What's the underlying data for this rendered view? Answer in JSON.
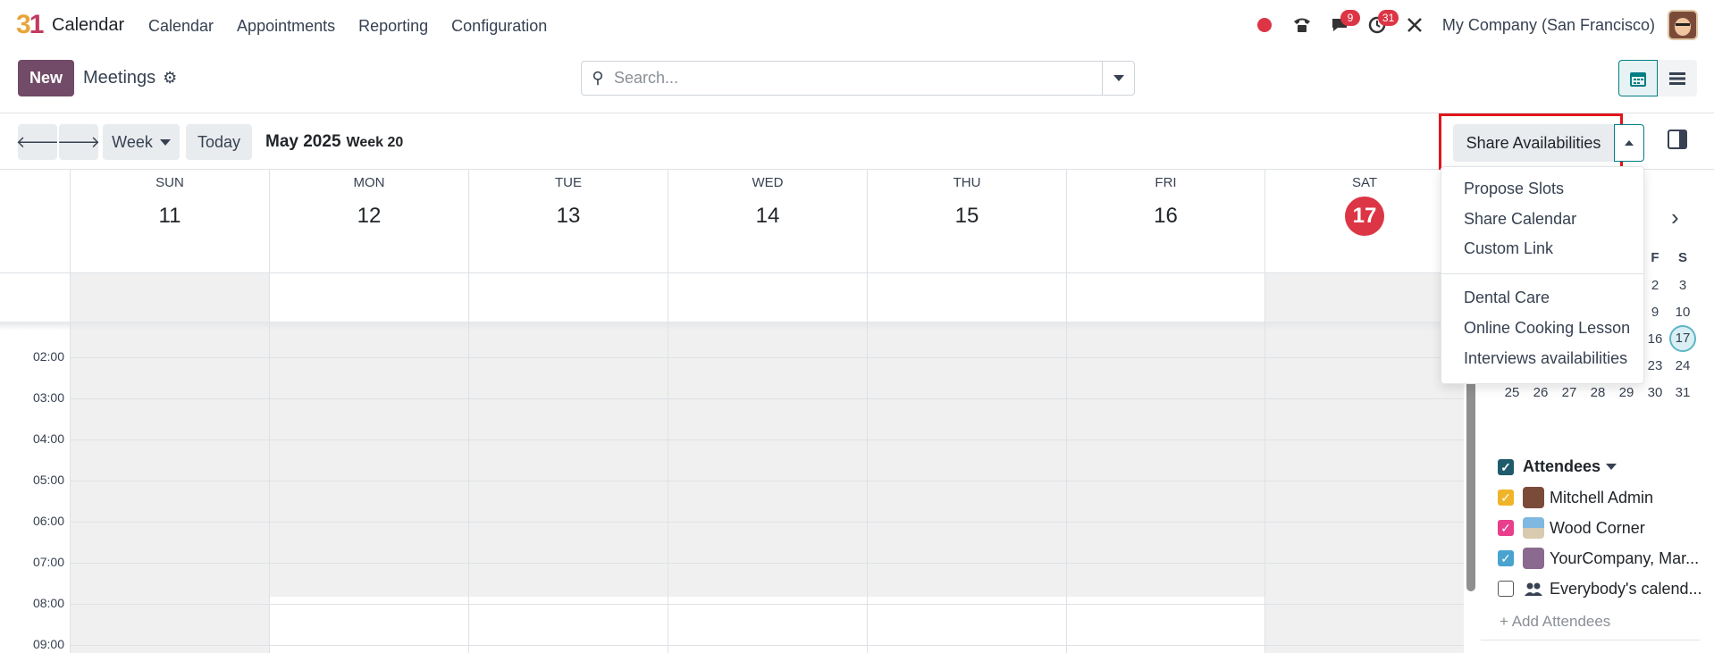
{
  "navbar": {
    "logo_digit_3": "3",
    "logo_digit_1": "1",
    "app_name": "Calendar",
    "menu": [
      "Calendar",
      "Appointments",
      "Reporting",
      "Configuration"
    ],
    "messages_count": "9",
    "activities_count": "31",
    "company": "My Company (San Francisco)"
  },
  "control_panel": {
    "new_label": "New",
    "title": "Meetings",
    "search_placeholder": "Search..."
  },
  "toolbar": {
    "scale_label": "Week",
    "today_label": "Today",
    "period": "May 2025",
    "week": "Week 20",
    "share_label": "Share Availabilities"
  },
  "calendar": {
    "days": [
      {
        "name": "SUN",
        "date": "11"
      },
      {
        "name": "MON",
        "date": "12"
      },
      {
        "name": "TUE",
        "date": "13"
      },
      {
        "name": "WED",
        "date": "14"
      },
      {
        "name": "THU",
        "date": "15"
      },
      {
        "name": "FRI",
        "date": "16"
      },
      {
        "name": "SAT",
        "date": "17"
      }
    ],
    "today_index": 6,
    "hours": [
      "02:00",
      "03:00",
      "04:00",
      "05:00",
      "06:00",
      "07:00",
      "08:00",
      "09:00"
    ]
  },
  "share_menu": {
    "items": [
      "Propose Slots",
      "Share Calendar",
      "Custom Link"
    ],
    "appointments": [
      "Dental Care",
      "Online Cooking Lesson",
      "Interviews availabilities"
    ]
  },
  "mini_calendar": {
    "headers": [
      "F",
      "S"
    ],
    "rows": [
      [
        "2",
        "3"
      ],
      [
        "9",
        "10"
      ],
      [
        "16",
        "17"
      ],
      [
        "23",
        "24"
      ],
      [
        "25",
        "26",
        "27",
        "28",
        "29",
        "30",
        "31"
      ]
    ],
    "selected": "17"
  },
  "attendees": {
    "title": "Attendees",
    "items": [
      {
        "label": "Mitchell Admin",
        "checked": true,
        "color": "#f0b429"
      },
      {
        "label": "Wood Corner",
        "checked": true,
        "color": "#e83e8c"
      },
      {
        "label": "YourCompany, Mar...",
        "checked": true,
        "color": "#4aa3cf"
      },
      {
        "label": "Everybody's calend...",
        "checked": false,
        "color": "#ffffff"
      }
    ],
    "add_label": "+ Add Attendees"
  },
  "colors": {
    "brand": "#714b67",
    "accent": "#017e84",
    "danger": "#dc3545",
    "highlight_box": "#e1151a",
    "weekend_bg": "#f0f0f0"
  }
}
